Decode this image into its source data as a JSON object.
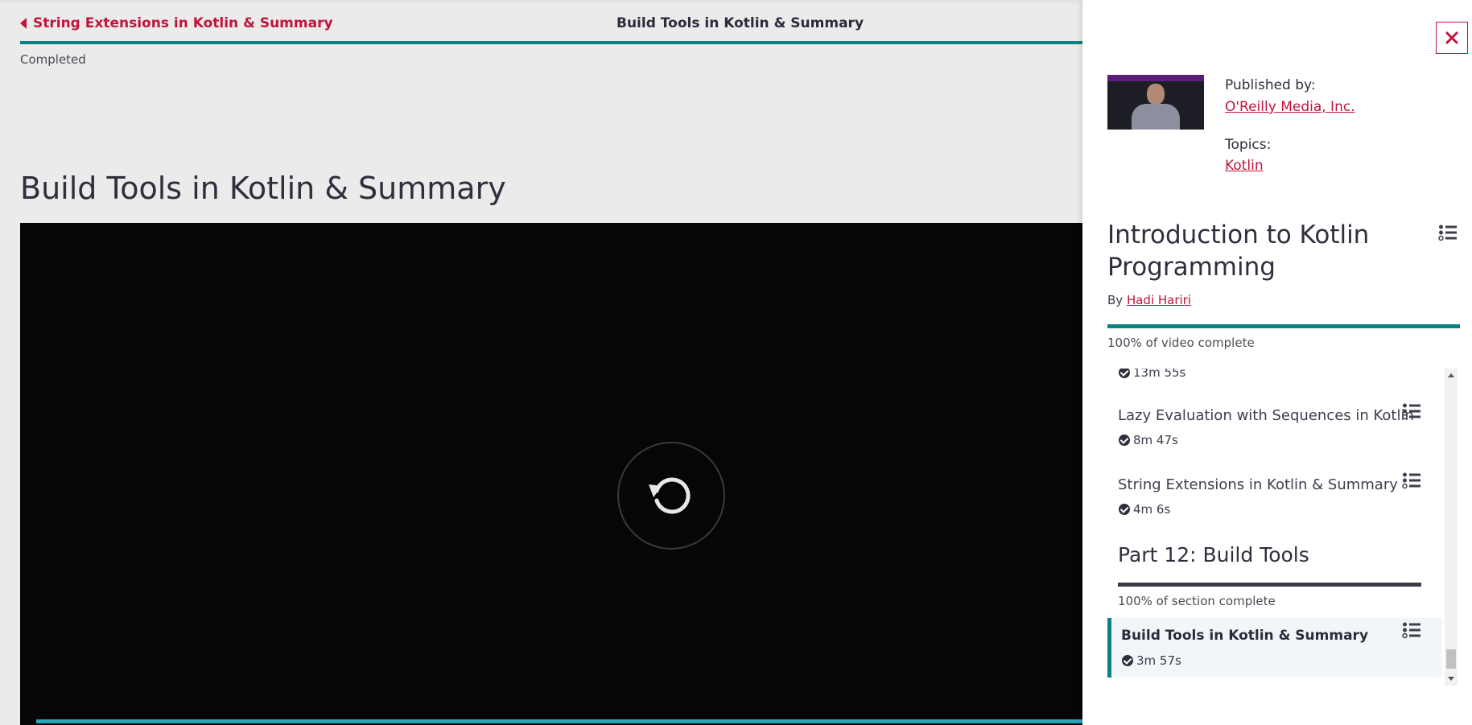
{
  "nav": {
    "prev_label": "String Extensions in Kotlin & Summary",
    "current_title": "Build Tools in Kotlin & Summary",
    "status": "Completed"
  },
  "main": {
    "title": "Build Tools in Kotlin & Summary",
    "video_progress": 1.0,
    "replay_icon": "replay-icon"
  },
  "panel": {
    "published_label": "Published by:",
    "publisher": "O'Reilly Media, Inc.",
    "topics_label": "Topics:",
    "topic": "Kotlin",
    "course_title": "Introduction to Kotlin Programming",
    "by_label": "By",
    "author": "Hadi Hariri",
    "course_progress_text": "100% of video complete",
    "items": [
      {
        "duration": "13m 55s"
      },
      {
        "title": "Lazy Evaluation with Sequences in Kotlin",
        "duration": "8m 47s"
      },
      {
        "title": "String Extensions in Kotlin & Summary",
        "duration": "4m 6s"
      }
    ],
    "section": {
      "title": "Part 12: Build Tools",
      "progress_text": "100% of section complete"
    },
    "active_item": {
      "title": "Build Tools in Kotlin & Summary",
      "duration": "3m 57s"
    }
  },
  "colors": {
    "accent": "#c1143b",
    "teal": "#0a8282",
    "video_bg": "#060606"
  }
}
